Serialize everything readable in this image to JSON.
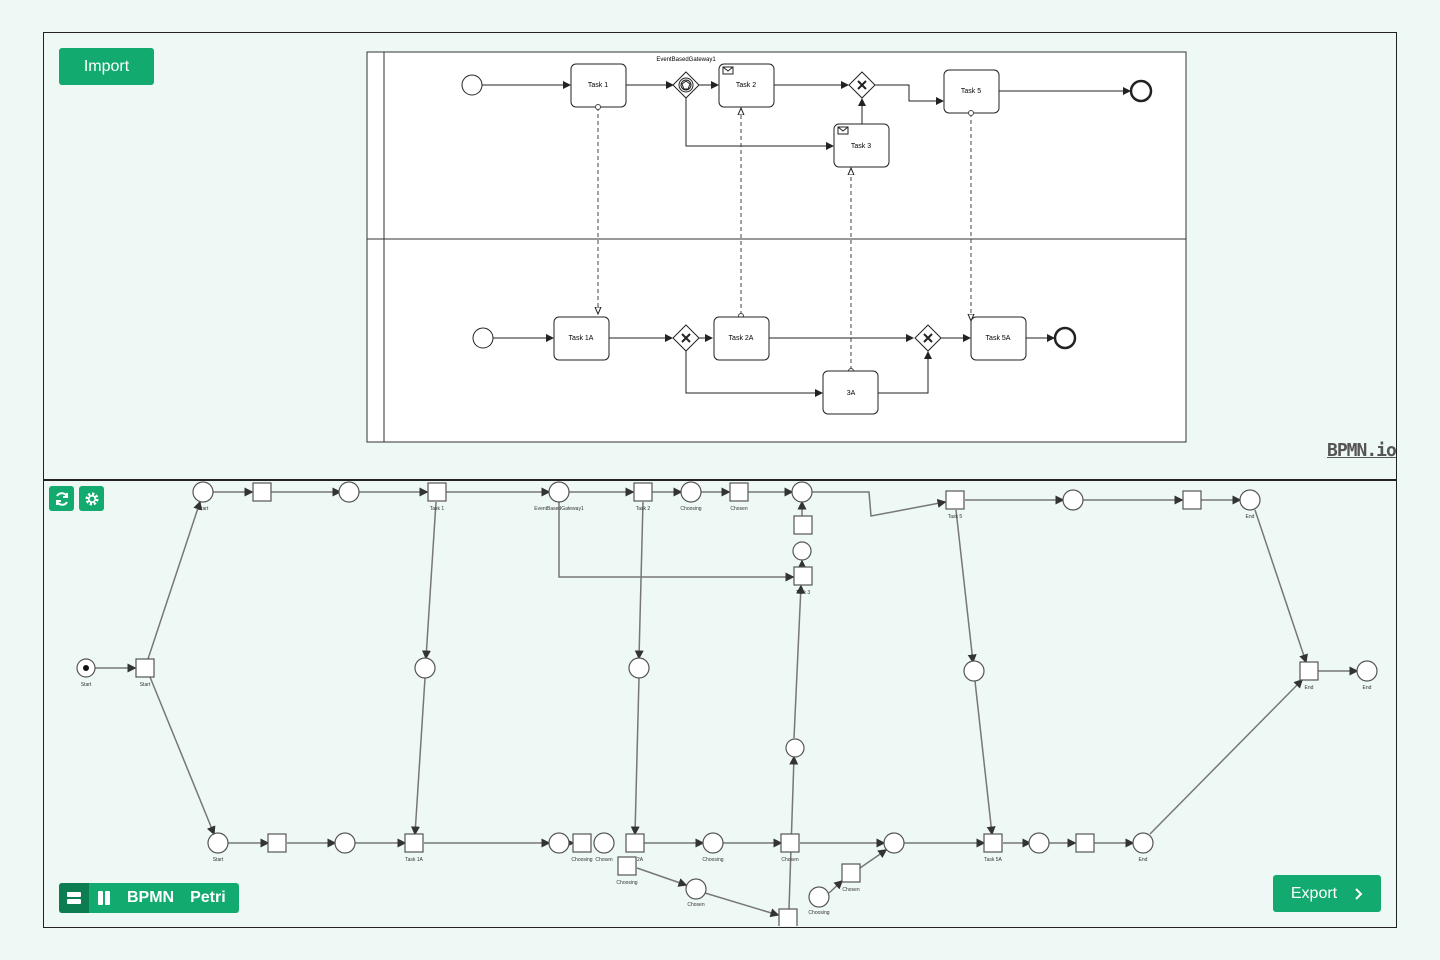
{
  "toolbar": {
    "import_label": "Import",
    "export_label": "Export",
    "refresh_icon": "refresh-icon",
    "settings_icon": "gear-icon"
  },
  "view_toggle": {
    "bpmn_label": "BPMN",
    "petri_label": "Petri",
    "icons": [
      "rows-layout-icon",
      "columns-layout-icon"
    ]
  },
  "brand": {
    "logo_text": "BPMN.io"
  },
  "colors": {
    "accent": "#12aa6e",
    "accent_dark": "#0c7d50",
    "background": "#eef8f4"
  },
  "bpmn": {
    "lane1": {
      "task1": "Task 1",
      "gateway": "EventBasedGateway1",
      "task2": "Task 2",
      "task3": "Task 3",
      "task5": "Task 5"
    },
    "lane2": {
      "task1a": "Task 1A",
      "task2a": "Task 2A",
      "task3a": "3A",
      "task5a": "Task 5A"
    }
  },
  "petri": {
    "start": "Start",
    "task1": "Task 1",
    "gateway": "EventBasedGateway1",
    "task2": "Task 2",
    "choosing": "Choosing",
    "chosen": "Chosen",
    "task3": "Task 3",
    "task5": "Task 5",
    "end": "End",
    "task1a": "Task 1A",
    "task2a": "2A",
    "task5a": "Task 5A",
    "a3": "3A"
  }
}
